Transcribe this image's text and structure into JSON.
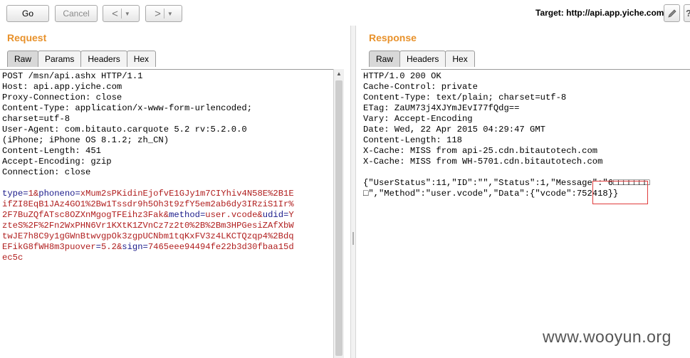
{
  "toolbar": {
    "go_label": "Go",
    "cancel_label": "Cancel",
    "back_glyph": "<",
    "forward_glyph": ">",
    "dropdown_glyph": "▼",
    "target_label": "Target: http://api.app.yiche.com",
    "edit_icon": "pencil-icon",
    "help_glyph": "?"
  },
  "request": {
    "title": "Request",
    "tabs": [
      "Raw",
      "Params",
      "Headers",
      "Hex"
    ],
    "active_tab": "Raw",
    "headers": [
      "POST /msn/api.ashx HTTP/1.1",
      "Host: api.app.yiche.com",
      "Proxy-Connection: close",
      "Content-Type: application/x-www-form-urlencoded;",
      "charset=utf-8",
      "User-Agent: com.bitauto.carquote 5.2 rv:5.2.0.0",
      "(iPhone; iPhone OS 8.1.2; zh_CN)",
      "Content-Length: 451",
      "Accept-Encoding: gzip",
      "Connection: close"
    ],
    "body_lines": [
      [
        {
          "t": "type",
          "c": "n"
        },
        {
          "t": "=",
          "c": "n"
        },
        {
          "t": "1",
          "c": "v"
        },
        {
          "t": "&",
          "c": "a"
        },
        {
          "t": "phoneno",
          "c": "n"
        },
        {
          "t": "=",
          "c": "n"
        },
        {
          "t": "xMum2sPKidinEjofvE1GJy1m7CIYhiv4N58E%2B1E",
          "c": "v"
        }
      ],
      [
        {
          "t": "ifZI8EqB1JAz4GO1%2Bw1Tssdr9h5Oh3t9zfY5em2ab6dy3IRziS1Ir%",
          "c": "v"
        }
      ],
      [
        {
          "t": "2F7BuZQfATsc8OZXnMgogTFEihz3Fak",
          "c": "v"
        },
        {
          "t": "&",
          "c": "a"
        },
        {
          "t": "method",
          "c": "n"
        },
        {
          "t": "=",
          "c": "n"
        },
        {
          "t": "user.vcode",
          "c": "v"
        },
        {
          "t": "&",
          "c": "a"
        },
        {
          "t": "udid",
          "c": "n"
        },
        {
          "t": "=",
          "c": "n"
        },
        {
          "t": "Y",
          "c": "v"
        }
      ],
      [
        {
          "t": "zteS%2F%2Fn2WxPHN6Vr1KXtK1ZVnCz7z2t0%2B%2Bm3HPGesiZAfXbW",
          "c": "v"
        }
      ],
      [
        {
          "t": "twJE7h8C9y1gGWnBtwvgpOk3zgpUCNbm1tqKxFV3z4LKCTQzqp4%2Bdq",
          "c": "v"
        }
      ],
      [
        {
          "t": "EFikG8fWH8m3puover",
          "c": "v"
        },
        {
          "t": "=",
          "c": "n"
        },
        {
          "t": "5.2",
          "c": "v"
        },
        {
          "t": "&",
          "c": "a"
        },
        {
          "t": "sign",
          "c": "n"
        },
        {
          "t": "=",
          "c": "n"
        },
        {
          "t": "7465eee94494fe22b3d30fbaa15d",
          "c": "v"
        }
      ],
      [
        {
          "t": "ec5c",
          "c": "v"
        }
      ]
    ]
  },
  "response": {
    "title": "Response",
    "tabs": [
      "Raw",
      "Headers",
      "Hex"
    ],
    "active_tab": "Raw",
    "lines": [
      "HTTP/1.0 200 OK",
      "Cache-Control: private",
      "Content-Type: text/plain; charset=utf-8",
      "ETag: ZaUM73j4XJYmJEvI77fQdg==",
      "Vary: Accept-Encoding",
      "Date: Wed, 22 Apr 2015 04:29:47 GMT",
      "Content-Length: 118",
      "X-Cache: MISS from api-25.cdn.bitautotech.com",
      "X-Cache: MISS from WH-5701.cdn.bitautotech.com",
      "",
      "{\"UserStatus\":11,\"ID\":\"\",\"Status\":1,\"Message\":\"6□□□□□□□",
      "□\",\"Method\":\"user.vcode\",\"Data\":{\"vcode\":752418}}"
    ]
  },
  "watermark": "www.wooyun.org"
}
